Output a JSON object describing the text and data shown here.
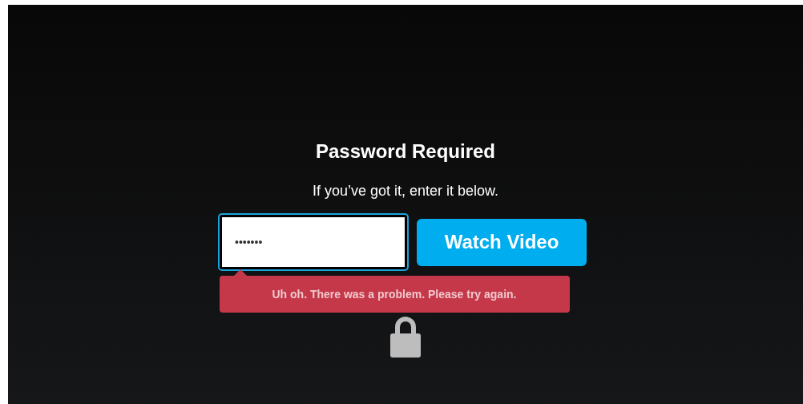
{
  "title": "Password Required",
  "subtitle": "If you’ve got it, enter it below.",
  "password_field": {
    "value": "•••••••",
    "focused": true
  },
  "submit_button": {
    "label": "Watch Video"
  },
  "error": {
    "message": "Uh oh. There was a problem. Please try again."
  }
}
